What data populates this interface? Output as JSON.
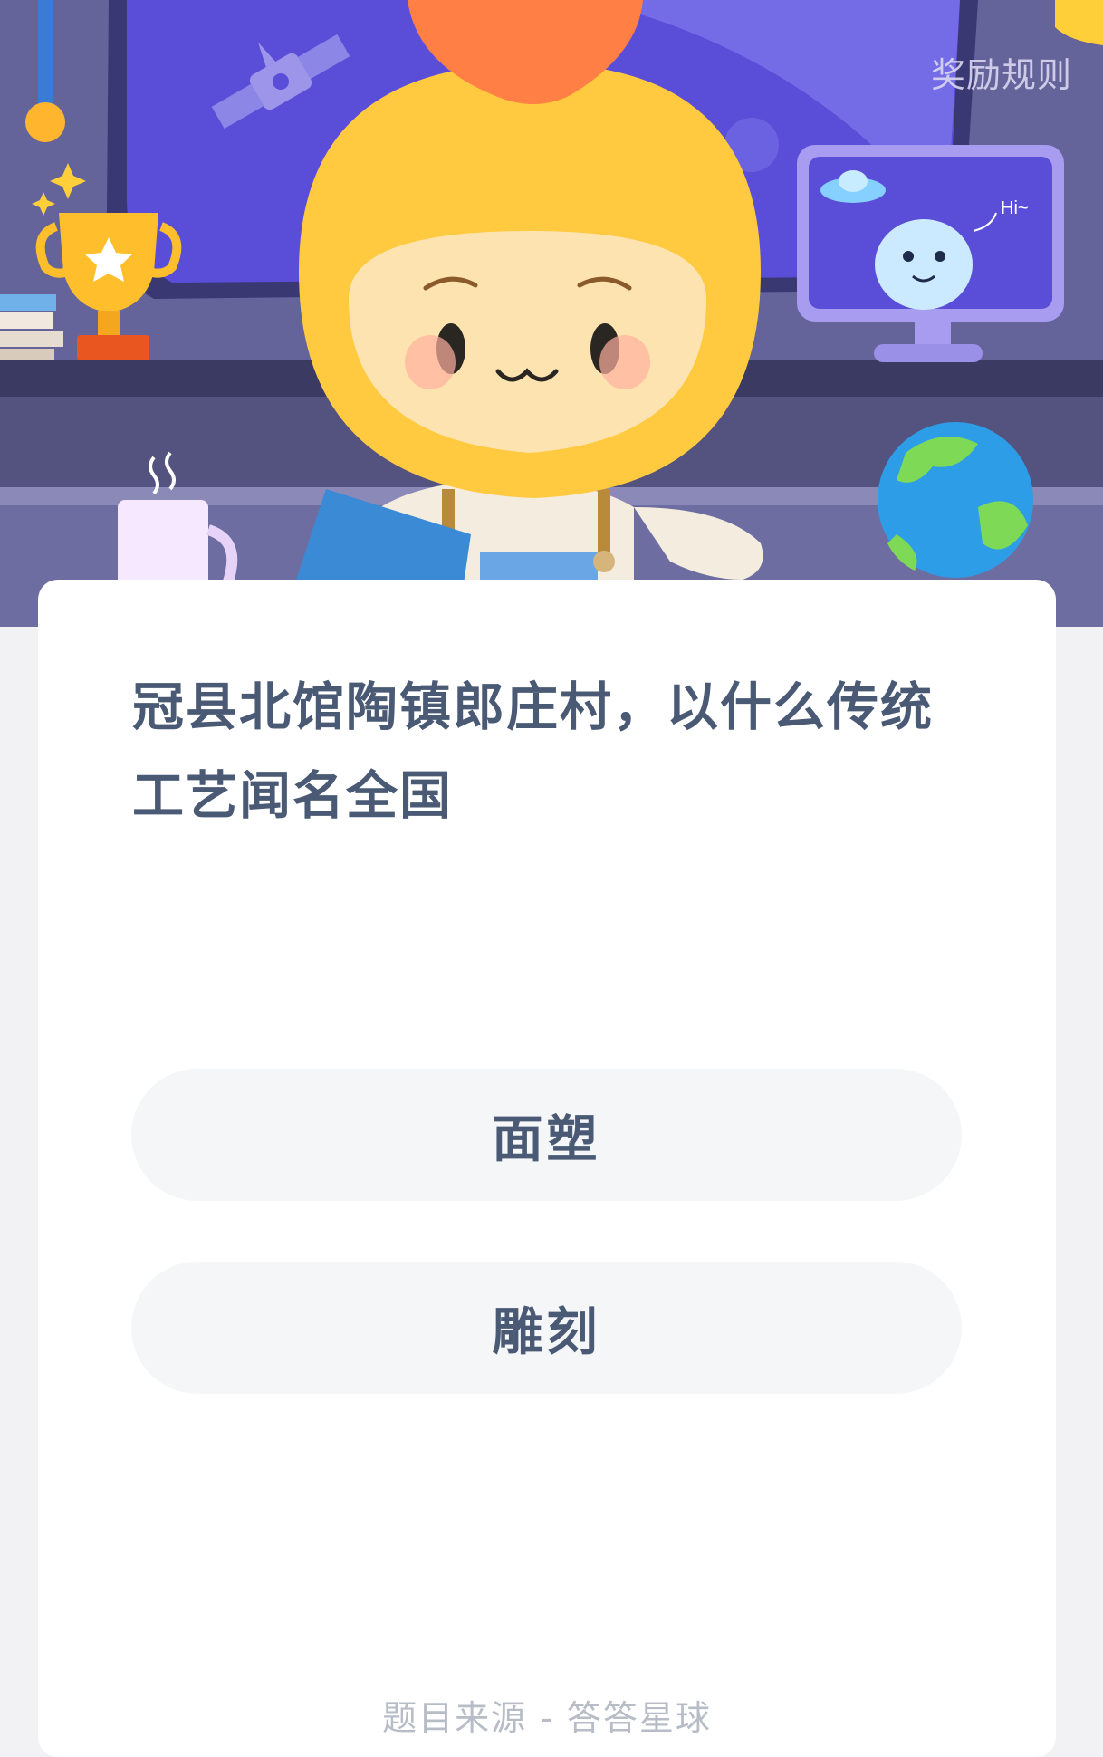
{
  "header": {
    "rules_link": "奖励规则",
    "monitor_greeting": "Hi~"
  },
  "quiz": {
    "question": "冠县北馆陶镇郎庄村，以什么传统工艺闻名全国",
    "options": [
      "面塑",
      "雕刻"
    ]
  },
  "footer": {
    "source": "题目来源 - 答答星球"
  },
  "colors": {
    "scene_bg": "#5d5c8e",
    "window_screen": "#5b4fd6",
    "mascot_yellow": "#ffc940",
    "mascot_hat": "#ff7f45",
    "card_bg": "#ffffff",
    "option_bg": "#f4f6f8",
    "question_text": "#4a5a75",
    "source_text": "#b7bcc6"
  }
}
